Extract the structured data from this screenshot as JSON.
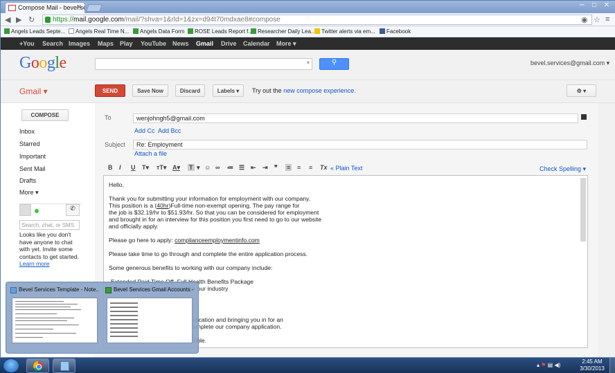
{
  "browser": {
    "tab_title": "Compose Mail - bevel.ser",
    "url_scheme": "https://",
    "url_host": "mail.google.com",
    "url_path": "/mail/?shva=1&rld=1&zx=d94t70mdxae8#compose",
    "bookmarks": [
      "Angels Leads Septe...",
      "Angels Real Time N...",
      "Angels Data Form",
      "ROSE Leads Report f...",
      "Researcher Daily Lea...",
      "Twitter alerts via em...",
      "Facebook"
    ]
  },
  "google_bar": [
    "+You",
    "Search",
    "Images",
    "Maps",
    "Play",
    "YouTube",
    "News",
    "Gmail",
    "Drive",
    "Calendar",
    "More"
  ],
  "header": {
    "logo": "Google",
    "account": "bevel.services@gmail.com"
  },
  "toolbar": {
    "app_name": "Gmail",
    "send": "SEND",
    "save_now": "Save Now",
    "discard": "Discard",
    "labels": "Labels",
    "tryout_prefix": "Try out the",
    "tryout_link": "new compose experience."
  },
  "nav": {
    "compose": "COMPOSE",
    "items": [
      "Inbox",
      "Starred",
      "Important",
      "Sent Mail",
      "Drafts",
      "More"
    ],
    "chat_placeholder": "Search, chat, or SMS",
    "chat_message": "Looks like you don't have anyone to chat with yet. Invite some contacts to get started.",
    "learn_more": "Learn more"
  },
  "compose": {
    "to_label": "To",
    "to_value": "wenjohngh5@gmail.com",
    "add_cc": "Add Cc",
    "add_bcc": "Add Bcc",
    "subject_label": "Subject",
    "subject_value": "Re: Employment",
    "attach": "Attach a file",
    "plain_text": "« Plain Text",
    "check_spelling": "Check Spelling",
    "body": {
      "greeting": "Hello,",
      "p1_line1_a": "Thank you for submitting your information for employment with our company.",
      "p1_line2_a": "This position is a (",
      "p1_line2_u": "40hr",
      "p1_line2_b": ")Full-time non-exempt opening. The pay range for",
      "p1_line3": "the job is $32.19/hr to $51.93/hr. So that you can be considered for employment",
      "p1_line4": "and brought in for an interview for this position you first need to go to our website",
      "p1_line5": "and officially apply.",
      "apply_prefix": "Please go here to apply: ",
      "apply_link": "complianceemploymentinfo.com",
      "p3": "Please take time to go through and complete the entire application process.",
      "p4": "Some generous benefits to working with our company include:",
      "benefit1": "-Extended Paid Time Off -Full Health Benefits Package",
      "benefit2": "-Higher than average salaries for our industry",
      "tail1": "plication and bringing you in for an",
      "tail2": "omplete our company application.",
      "tail3": "sible."
    }
  },
  "previews": [
    {
      "title": "Bevel Services Template - Note..."
    },
    {
      "title": "Bevel Services Gmail Accounts -..."
    }
  ],
  "taskbar": {
    "time": "2:45 AM",
    "date": "3/30/2013"
  }
}
